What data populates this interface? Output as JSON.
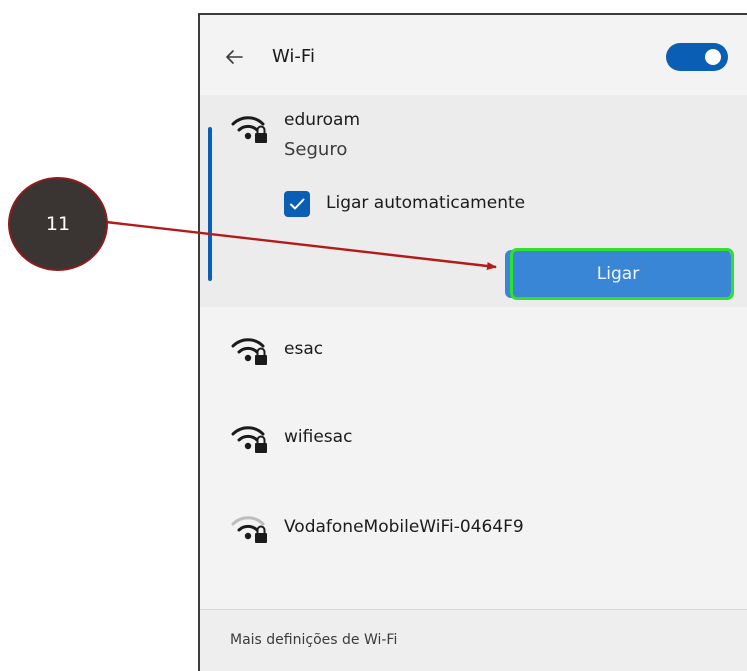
{
  "header": {
    "title": "Wi-Fi",
    "back_icon": "back-arrow-icon",
    "toggle_state": "on"
  },
  "networks": [
    {
      "name": "eduroam",
      "status": "Seguro",
      "expanded": true,
      "auto_connect_label": "Ligar automaticamente",
      "auto_connect_checked": true,
      "connect_label": "Ligar"
    },
    {
      "name": "esac"
    },
    {
      "name": "wifiesac"
    },
    {
      "name": "VodafoneMobileWiFi-0464F9"
    }
  ],
  "footer": {
    "link_label": "Mais definições de Wi-Fi"
  },
  "annotation": {
    "step_number": "11"
  },
  "colors": {
    "accent": "#0a5fb4",
    "button": "#3a86d6",
    "highlight": "#2fe02f",
    "arrow": "#b31b1b",
    "callout_fill": "#3a3432"
  }
}
